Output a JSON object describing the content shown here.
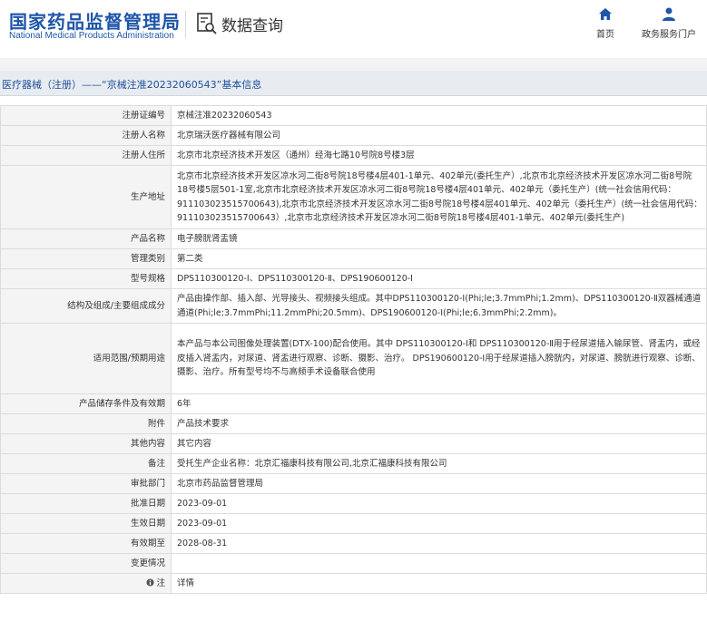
{
  "header": {
    "logo_cn": "国家药品监督管理局",
    "logo_en": "National Medical Products Administration",
    "query_label": "数据查询",
    "nav": [
      {
        "label": "首页",
        "icon": "home-icon"
      },
      {
        "label": "政务服务门户",
        "icon": "user-icon"
      }
    ]
  },
  "title": "医疗器械（注册）——“京械注准20232060543”基本信息",
  "rows": [
    {
      "key": "注册证编号",
      "value": "京械注准20232060543"
    },
    {
      "key": "注册人名称",
      "value": "北京瑞沃医疗器械有限公司"
    },
    {
      "key": "注册人住所",
      "value": "北京市北京经济技术开发区（通州）经海七路10号院8号楼3层"
    },
    {
      "key": "生产地址",
      "value": "北京市北京经济技术开发区凉水河二街8号院18号楼4层401-1单元、402单元(委托生产）,北京市北京经济技术开发区凉水河二街8号院18号楼5层501-1室,北京市北京经济技术开发区凉水河二街8号院18号楼4层401单元、402单元（委托生产）(统一社会信用代码：911103023515700643),北京市北京经济技术开发区凉水河二街8号院18号楼4层401单元、402单元（委托生产）(统一社会信用代码：911103023515700643）,北京市北京经济技术开发区凉水河二街8号院18号楼4层401-1单元、402单元(委托生产)"
    },
    {
      "key": "产品名称",
      "value": "电子膀胱肾盂镜"
    },
    {
      "key": "管理类别",
      "value": "第二类"
    },
    {
      "key": "型号规格",
      "value": "DPS110300120-Ⅰ、DPS110300120-Ⅱ、DPS190600120-Ⅰ"
    },
    {
      "key": "结构及组成/主要组成成分",
      "value": "产品由操作部、插入部、光导接头、视频接头组成。其中DPS110300120-Ⅰ(Phi;le;3.7mmPhi;1.2mm)、DPS110300120-Ⅱ双器械通道通道(Phi;le;3.7mmPhi;11.2mmPhi;20.5mm)、DPS190600120-Ⅰ(Phi;le;6.3mmPhi;2.2mm)。"
    },
    {
      "key": "适用范围/预期用途",
      "value": "本产品与本公司图像处理装置(DTX-100)配合使用。其中 DPS110300120-Ⅰ和 DPS110300120-Ⅱ用于经尿道插入输尿管、肾盂内，或经皮插入肾盂内，对尿道、肾盂进行观察、诊断、摄影、治疗。 DPS190600120-Ⅰ用于经尿道插入膀胱内，对尿道、膀胱进行观察、诊断、摄影、治疗。所有型号均不与高频手术设备联合使用"
    },
    {
      "key": "产品储存条件及有效期",
      "value": "6年"
    },
    {
      "key": "附件",
      "value": "产品技术要求"
    },
    {
      "key": "其他内容",
      "value": "其它内容"
    },
    {
      "key": "备注",
      "value": "受托生产企业名称：北京汇福康科技有限公司,北京汇福康科技有限公司"
    },
    {
      "key": "审批部门",
      "value": "北京市药品监督管理局"
    },
    {
      "key": "批准日期",
      "value": "2023-09-01"
    },
    {
      "key": "生效日期",
      "value": "2023-09-01"
    },
    {
      "key": "有效期至",
      "value": "2028-08-31"
    },
    {
      "key": "变更情况",
      "value": ""
    },
    {
      "key": "注",
      "value": "详情",
      "key_icon": "info-icon"
    }
  ],
  "colors": {
    "brand": "#1f56a8",
    "title_bg": "#e8ecf1",
    "key_bg": "#f4f4f4"
  }
}
